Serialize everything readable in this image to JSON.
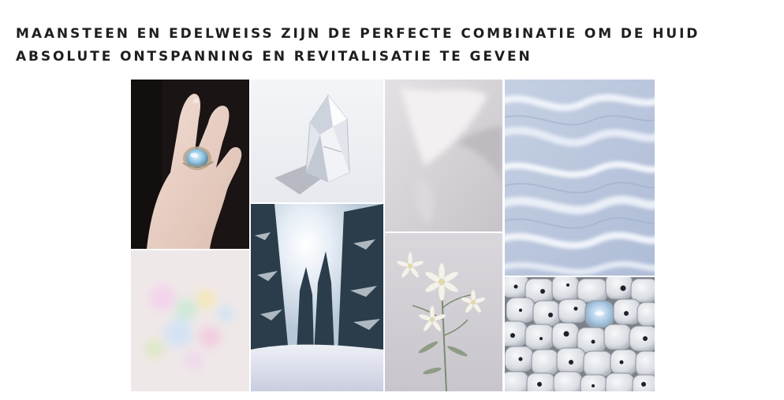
{
  "headline": {
    "line1": "MAANSTEEN EN EDELWEISS ZIJN DE PERFECTE COMBINATIE OM DE HUID",
    "line2": "ABSOLUTE ONTSPANNING EN REVITALISATIE TE GEVEN"
  },
  "colors": {
    "text": "#1e1e1e",
    "background": "#ffffff",
    "moonstone_blue": "#a9c8e3",
    "lavender_grey": "#c7cfe2"
  }
}
